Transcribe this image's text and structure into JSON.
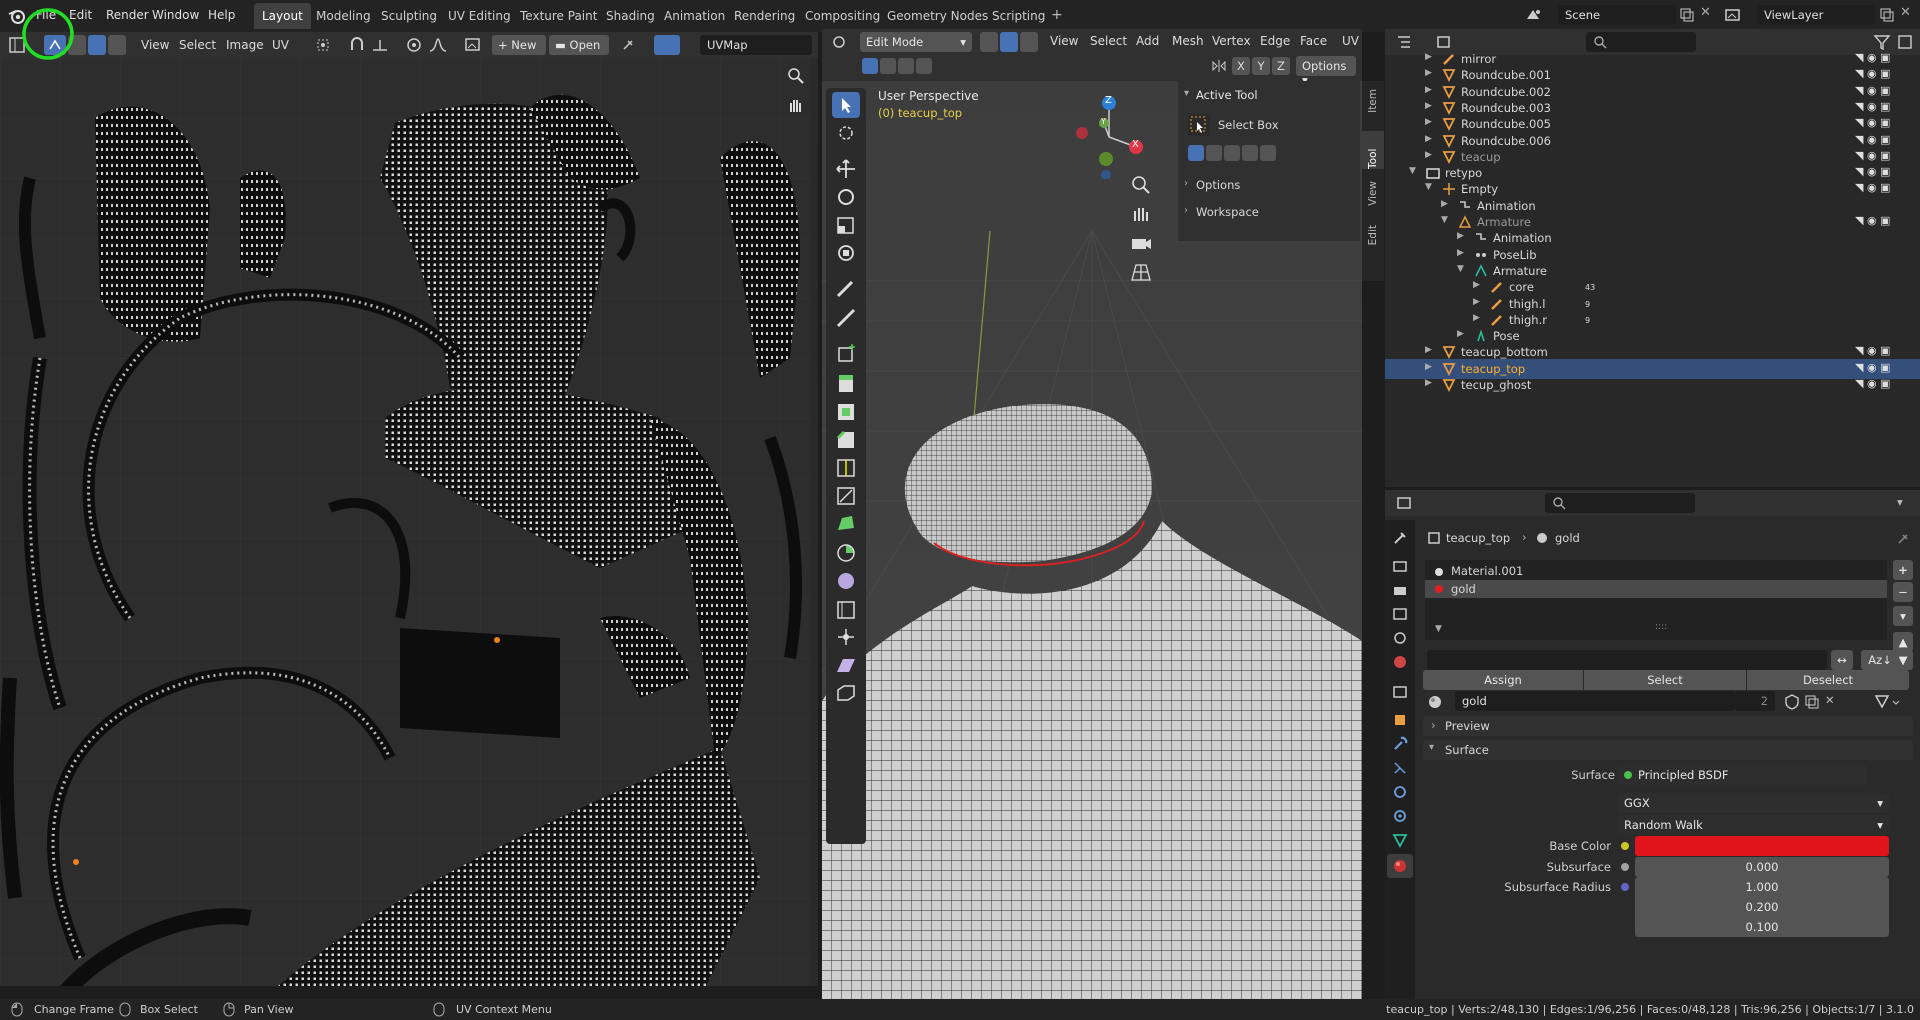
{
  "menu": {
    "file": "File",
    "edit": "Edit",
    "render": "Render",
    "window": "Window",
    "help": "Help"
  },
  "workspaces": [
    "Layout",
    "Modeling",
    "Sculpting",
    "UV Editing",
    "Texture Paint",
    "Shading",
    "Animation",
    "Rendering",
    "Compositing",
    "Geometry Nodes",
    "Scripting"
  ],
  "scene": {
    "scene_name": "Scene",
    "view_layer": "ViewLayer"
  },
  "uv_editor": {
    "menus": {
      "view": "View",
      "select": "Select",
      "image": "Image",
      "uv": "UV"
    },
    "new_label": "New",
    "open_label": "Open",
    "uvmap": "UVMap"
  },
  "viewport": {
    "mode": "Edit Mode",
    "menus": {
      "view": "View",
      "select": "Select",
      "add": "Add",
      "mesh": "Mesh",
      "vertex": "Vertex",
      "edge": "Edge",
      "face": "Face",
      "uv": "UV"
    },
    "axes": {
      "x": "X",
      "y": "Y",
      "z": "Z"
    },
    "options_label": "Options",
    "perspective": "User Perspective",
    "object_label": "(0) teacup_top",
    "gizmo": {
      "x": "X",
      "y": "Y",
      "z": "Z"
    },
    "tabs": {
      "item": "Item",
      "tool": "Tool",
      "view": "View",
      "edit": "Edit"
    },
    "npanel": {
      "active_tool": "Active Tool",
      "select_box": "Select Box",
      "options": "Options",
      "workspace": "Workspace"
    }
  },
  "outliner": {
    "rows": [
      {
        "name": "mirror",
        "indent": 1,
        "type": "bone",
        "sel": false
      },
      {
        "name": "Roundcube.001",
        "indent": 1,
        "type": "mesh",
        "sel": false
      },
      {
        "name": "Roundcube.002",
        "indent": 1,
        "type": "mesh",
        "sel": false
      },
      {
        "name": "Roundcube.003",
        "indent": 1,
        "type": "mesh",
        "sel": false
      },
      {
        "name": "Roundcube.005",
        "indent": 1,
        "type": "mesh",
        "sel": false
      },
      {
        "name": "Roundcube.006",
        "indent": 1,
        "type": "mesh",
        "sel": false
      },
      {
        "name": "teacup",
        "indent": 1,
        "type": "mesh",
        "sel": false
      },
      {
        "name": "retypo",
        "indent": 0,
        "type": "collection",
        "sel": false
      },
      {
        "name": "Empty",
        "indent": 1,
        "type": "empty",
        "sel": false
      },
      {
        "name": "Animation",
        "indent": 2,
        "type": "anim",
        "sel": false
      },
      {
        "name": "Armature",
        "indent": 2,
        "type": "armature",
        "sel": false
      },
      {
        "name": "Animation",
        "indent": 3,
        "type": "anim",
        "sel": false
      },
      {
        "name": "PoseLib",
        "indent": 3,
        "type": "poselib",
        "sel": false
      },
      {
        "name": "Armature",
        "indent": 3,
        "type": "armdata",
        "sel": false
      },
      {
        "name": "core",
        "indent": 4,
        "type": "bone",
        "sel": false
      },
      {
        "name": "thigh.l",
        "indent": 4,
        "type": "bone",
        "sel": false
      },
      {
        "name": "thigh.r",
        "indent": 4,
        "type": "bone",
        "sel": false
      },
      {
        "name": "Pose",
        "indent": 3,
        "type": "pose",
        "sel": false
      },
      {
        "name": "teacup_bottom",
        "indent": 1,
        "type": "mesh",
        "sel": false
      },
      {
        "name": "teacup_top",
        "indent": 1,
        "type": "mesh",
        "sel": true
      },
      {
        "name": "tecup_ghost",
        "indent": 1,
        "type": "mesh",
        "sel": false
      }
    ],
    "badges": {
      "core": "43",
      "thigh_l": "9",
      "thigh_r": "9"
    }
  },
  "properties": {
    "breadcrumb_object": "teacup_top",
    "breadcrumb_material": "gold",
    "slots": [
      "Material.001",
      "gold"
    ],
    "assign": "Assign",
    "select": "Select",
    "deselect": "Deselect",
    "material_name": "gold",
    "user_count": "2",
    "preview": "Preview",
    "surface_section": "Surface",
    "surface_label": "Surface",
    "surface_value": "Principled BSDF",
    "distribution": "GGX",
    "subsurface_method": "Random Walk",
    "base_color_label": "Base Color",
    "base_color": "#e0141a",
    "subsurface_label": "Subsurface",
    "subsurface_value": "0.000",
    "subsurface_radius_label": "Subsurface Radius",
    "subsurface_radius": [
      "1.000",
      "0.200",
      "0.100"
    ]
  },
  "status": {
    "change_frame": "Change Frame",
    "box_select": "Box Select",
    "pan_view": "Pan View",
    "uv_context_menu": "UV Context Menu",
    "stats": "teacup_top | Verts:2/48,130 | Edges:1/96,256 | Faces:0/48,128 | Tris:96,256 | Objects:1/7 | 3.1.0"
  },
  "colors": {
    "accent": "#4772b3",
    "selected_row": "#344f7a",
    "highlight_circle": "#22dd22",
    "mesh_icon": "#e89d45",
    "data_icon": "#2bbd9a"
  }
}
